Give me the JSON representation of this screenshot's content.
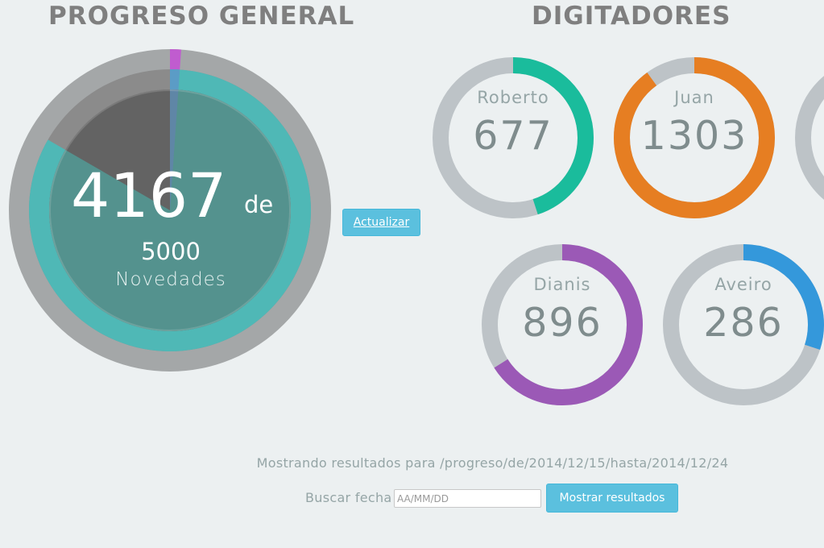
{
  "progress": {
    "title": "PROGRESO GENERAL",
    "count": "4167",
    "de_label": "de",
    "total": "5000",
    "units_label": "Novedades",
    "chart_data": {
      "type": "pie",
      "value": 4167,
      "total": 5000,
      "colors": {
        "outer_track": "#a4a7a8",
        "outer_tick": "#c05ccf",
        "middle_track": "#8b8b8b",
        "middle_fill": "#4fb8b6",
        "middle_tick": "#5b9cc6",
        "inner_track": "#636363",
        "inner_fill": "#54928e"
      }
    }
  },
  "refresh_button": {
    "label": "Actualizar"
  },
  "typists": {
    "title": "DIGITADORES",
    "items": [
      {
        "name": "Roberto",
        "count": "677",
        "progress": 0.45,
        "color": "#1abc9c"
      },
      {
        "name": "Juan",
        "count": "1303",
        "progress": 0.9,
        "color": "#e67e22"
      },
      {
        "name": "Dianis",
        "count": "896",
        "progress": 0.66,
        "color": "#9b59b6"
      },
      {
        "name": "Aveiro",
        "count": "286",
        "progress": 0.3,
        "color": "#3498db"
      }
    ],
    "track_color": "#bdc3c7"
  },
  "footer": {
    "results_text": "Mostrando resultados para /progreso/de/2014/12/15/hasta/2014/12/24",
    "date_label": "Buscar fecha",
    "date_placeholder": "AA/MM/DD",
    "show_button": "Mostrar resultados"
  }
}
